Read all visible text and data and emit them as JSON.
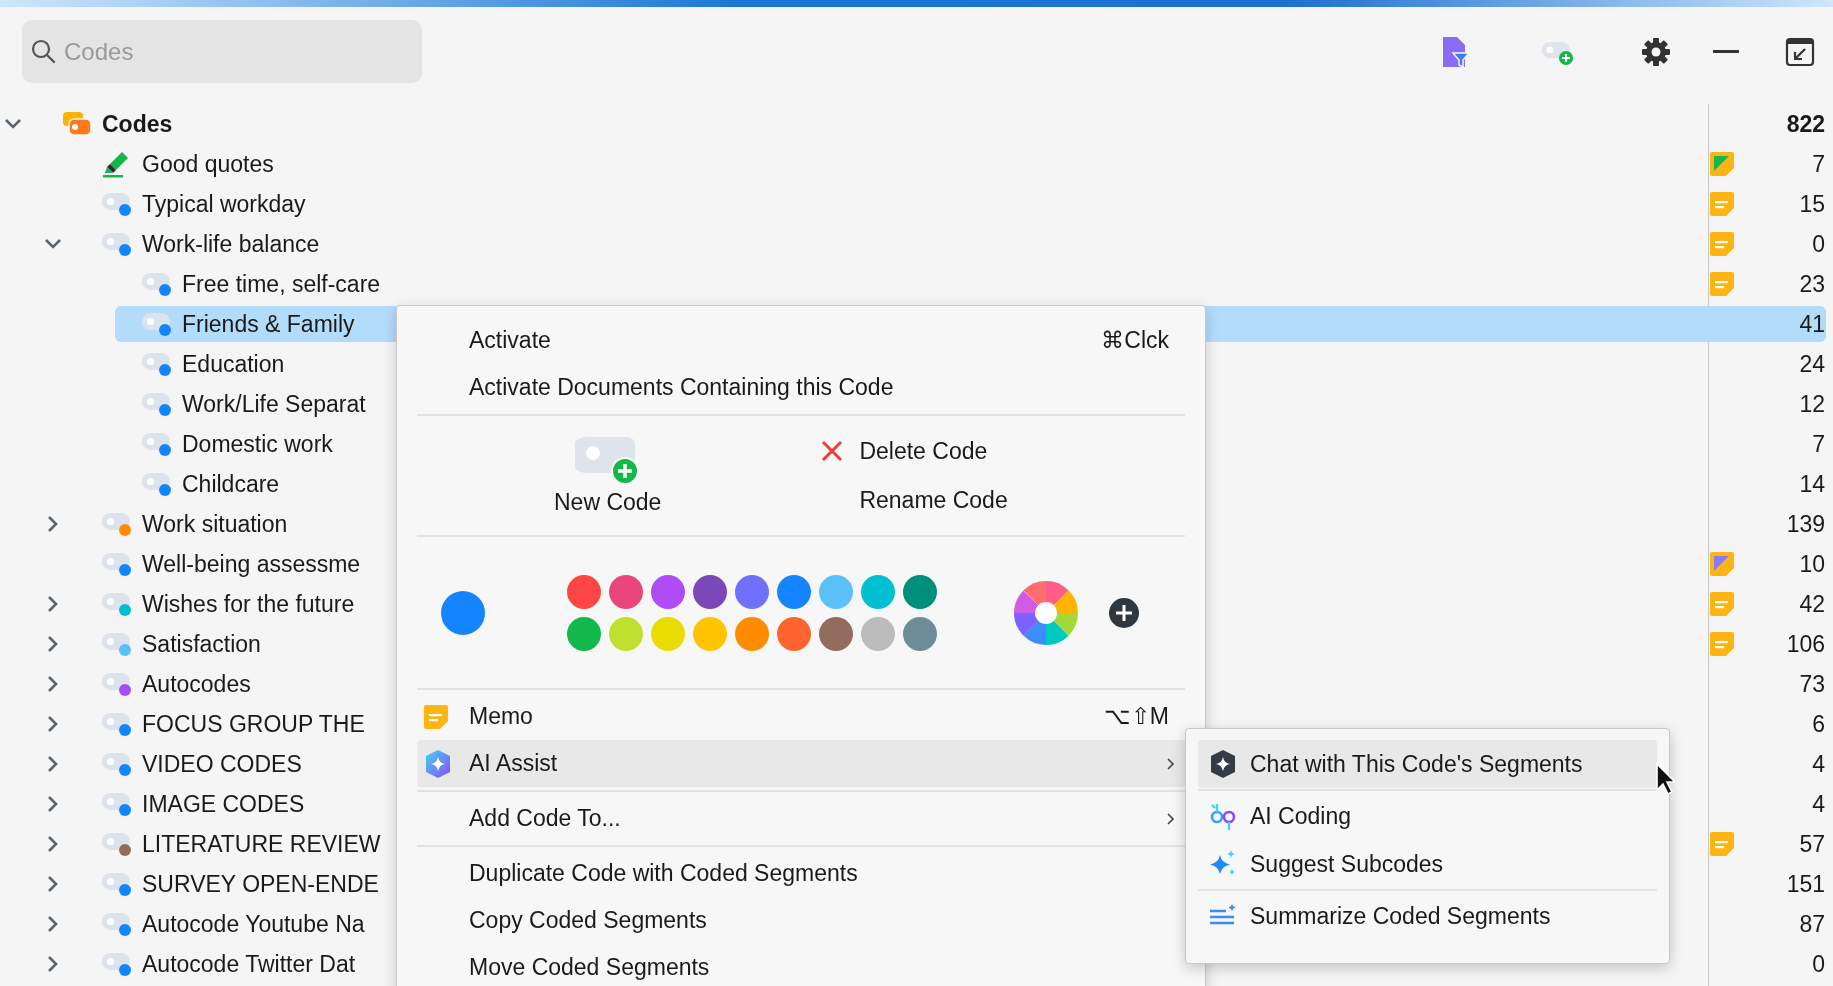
{
  "search": {
    "placeholder": "Codes"
  },
  "tree": {
    "kind": "root",
    "name": "Codes",
    "count": "822",
    "expanded": true,
    "selected": false,
    "children": [
      {
        "kind": "highlight",
        "name": "Good quotes",
        "count": "7",
        "selected": false,
        "memo": {
          "kind": "corner",
          "color": "#12b84a"
        }
      },
      {
        "kind": "code",
        "name": "Typical workday",
        "count": "15",
        "color": "#1485ff",
        "selected": false,
        "memo": {
          "kind": "lines"
        }
      },
      {
        "kind": "code",
        "name": "Work-life balance",
        "count": "0",
        "color": "#1485ff",
        "selected": false,
        "expanded": true,
        "memo": {
          "kind": "lines"
        },
        "children": [
          {
            "kind": "code",
            "name": "Free time, self-care",
            "count": "23",
            "color": "#1485ff",
            "selected": false,
            "memo": {
              "kind": "lines"
            }
          },
          {
            "kind": "code",
            "name": "Friends & Family",
            "count": "41",
            "color": "#1485ff",
            "selected": true
          },
          {
            "kind": "code",
            "name": "Education",
            "count": "24",
            "color": "#1485ff",
            "selected": false
          },
          {
            "kind": "code",
            "name": "Work/Life Separat",
            "count": "12",
            "color": "#1485ff",
            "selected": false
          },
          {
            "kind": "code",
            "name": "Domestic work",
            "count": "7",
            "color": "#1485ff",
            "selected": false
          },
          {
            "kind": "code",
            "name": "Childcare",
            "count": "14",
            "color": "#1485ff",
            "selected": false
          }
        ]
      },
      {
        "kind": "code",
        "name": "Work situation",
        "count": "139",
        "color": "#ff8c00",
        "selected": false,
        "expanded": false
      },
      {
        "kind": "code",
        "name": "Well-being assessme",
        "count": "10",
        "color": "#1485ff",
        "selected": false,
        "memo": {
          "kind": "corner",
          "color": "#8a7cf8"
        }
      },
      {
        "kind": "code",
        "name": "Wishes for the future",
        "count": "42",
        "color": "#00bfd0",
        "selected": false,
        "expanded": false,
        "memo": {
          "kind": "lines"
        }
      },
      {
        "kind": "code",
        "name": "Satisfaction",
        "count": "106",
        "color": "#5ac0fa",
        "selected": false,
        "expanded": false,
        "memo": {
          "kind": "lines"
        }
      },
      {
        "kind": "code",
        "name": "Autocodes",
        "count": "73",
        "color": "#a84cf0",
        "selected": false,
        "expanded": false
      },
      {
        "kind": "code",
        "name": "FOCUS GROUP THE",
        "count": "6",
        "color": "#1485ff",
        "selected": false,
        "expanded": false
      },
      {
        "kind": "code",
        "name": "VIDEO CODES",
        "count": "4",
        "color": "#1485ff",
        "selected": false,
        "expanded": false
      },
      {
        "kind": "code",
        "name": "IMAGE CODES",
        "count": "4",
        "color": "#1485ff",
        "selected": false,
        "expanded": false
      },
      {
        "kind": "code",
        "name": "LITERATURE REVIEW",
        "count": "57",
        "color": "#946c5e",
        "selected": false,
        "expanded": false,
        "memo": {
          "kind": "lines"
        }
      },
      {
        "kind": "code",
        "name": "SURVEY OPEN-ENDE",
        "count": "151",
        "color": "#1485ff",
        "selected": false,
        "expanded": false
      },
      {
        "kind": "code",
        "name": "Autocode Youtube Na",
        "count": "87",
        "color": "#1485ff",
        "selected": false,
        "expanded": false
      },
      {
        "kind": "code",
        "name": "Autocode Twitter Dat",
        "count": "0",
        "color": "#1485ff",
        "selected": false,
        "expanded": false
      }
    ]
  },
  "menu": {
    "items": [
      {
        "kind": "item",
        "label": "Activate",
        "shortcut": "⌘Clck",
        "selected": false
      },
      {
        "kind": "item",
        "label": "Activate Documents Containing this Code",
        "selected": false
      },
      {
        "kind": "separator"
      },
      {
        "kind": "actions",
        "new_code": "New Code",
        "delete": "Delete Code",
        "rename": "Rename Code"
      },
      {
        "kind": "separator"
      },
      {
        "kind": "colors",
        "color": "#1485ff",
        "palette": [
          {
            "color": "#ff4646"
          },
          {
            "color": "#e8457a"
          },
          {
            "color": "#b04cf5"
          },
          {
            "color": "#7a48b8"
          },
          {
            "color": "#7070fa"
          },
          {
            "color": "#1485ff"
          },
          {
            "color": "#5ac0fa"
          },
          {
            "color": "#00bfd0"
          },
          {
            "color": "#008f7d"
          },
          {
            "color": "#12b84a"
          },
          {
            "color": "#c0e030"
          },
          {
            "color": "#e8dc00"
          },
          {
            "color": "#ffc400"
          },
          {
            "color": "#ff8c00"
          },
          {
            "color": "#ff6430"
          },
          {
            "color": "#946c5e"
          },
          {
            "color": "#bcbcbc"
          },
          {
            "color": "#6f8d99"
          }
        ]
      },
      {
        "kind": "separator"
      },
      {
        "kind": "memo",
        "label": "Memo",
        "shortcut": "⌥⇧M",
        "selected": false
      },
      {
        "kind": "assist",
        "label": "AI Assist",
        "has_submenu": true,
        "selected": true
      },
      {
        "kind": "separator"
      },
      {
        "kind": "item",
        "label": "Add Code To...",
        "has_submenu": true,
        "selected": false
      },
      {
        "kind": "separator"
      },
      {
        "kind": "item",
        "label": "Duplicate Code with Coded Segments",
        "selected": false
      },
      {
        "kind": "item",
        "label": "Copy Coded Segments",
        "selected": false
      },
      {
        "kind": "item",
        "label": "Move Coded Segments",
        "selected": false
      }
    ]
  },
  "submenu": {
    "items": [
      {
        "kind": "chat",
        "label": "Chat with This Code's Segments",
        "selected": true
      },
      {
        "kind": "separator"
      },
      {
        "kind": "coding",
        "label": "AI Coding",
        "selected": false
      },
      {
        "kind": "suggest",
        "label": "Suggest Subcodes",
        "selected": false
      },
      {
        "kind": "separator"
      },
      {
        "kind": "summarize",
        "label": "Summarize Coded Segments",
        "selected": false
      }
    ]
  }
}
